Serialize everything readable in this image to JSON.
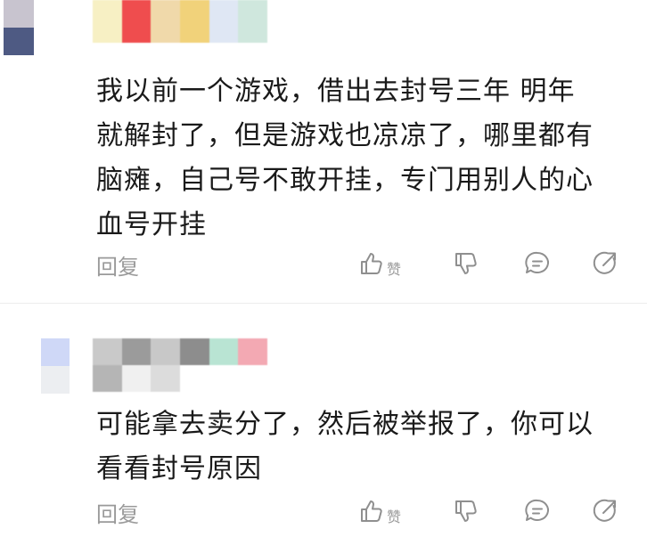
{
  "comments": [
    {
      "avatar_colors": [
        "#c8c4cf",
        "#ffffff",
        "#4e5a83",
        "#ffffff"
      ],
      "name_colors": [
        "#f7f0c4",
        "#ef4d4e",
        "#f0d9aa",
        "#f1d27a",
        "#dfe7f4",
        "#cfe7dd"
      ],
      "text": "我以前一个游戏，借出去封号三年 明年\n就解封了，但是游戏也凉凉了，哪里都有\n脑瘫，自己号不敢开挂，专门用别人的心\n血号开挂",
      "reply_label": "回复",
      "like_label": "赞"
    },
    {
      "avatar_colors": [
        "#ffffff",
        "#cfd8f7",
        "#ffffff",
        "#eceef1"
      ],
      "name_colors": [
        "#c9c9c9",
        "#9b9b9b",
        "#c8c8c8",
        "#8d8d8d",
        "#b9e4d3",
        "#f3a9b3",
        "#b5b5b5",
        "#f0f0f0",
        "#dcdcdc",
        "#ffffff",
        "#ffffff",
        "#ffffff"
      ],
      "text": "可能拿去卖分了，然后被举报了，你可以\n看看封号原因",
      "reply_label": "回复",
      "like_label": "赞"
    }
  ],
  "icon_color": "#8f8f8f"
}
